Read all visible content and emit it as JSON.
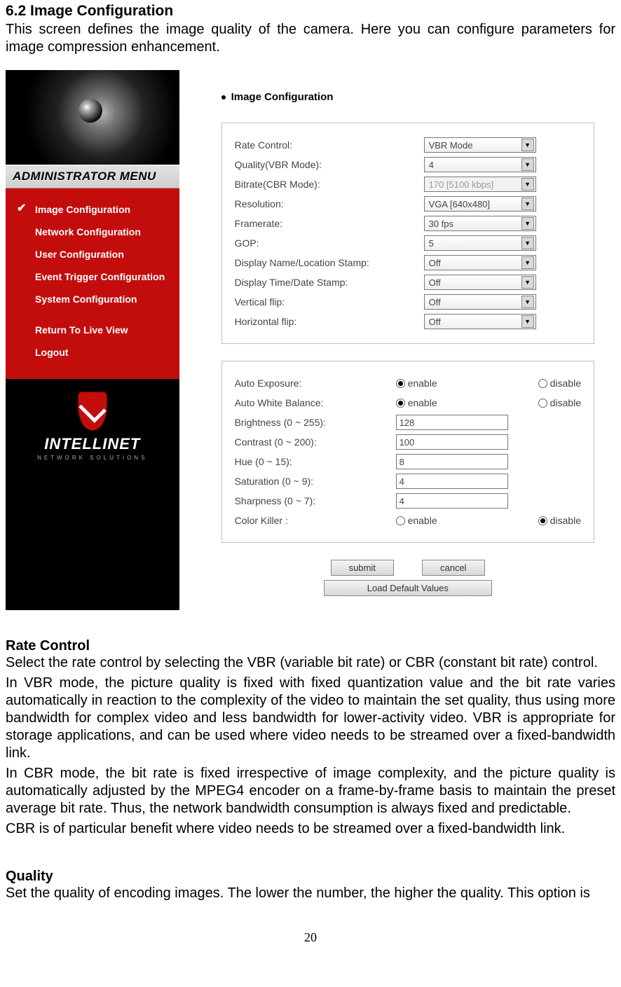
{
  "heading": "6.2 Image Configuration",
  "intro": "This screen defines the image quality of the camera. Here you can configure parameters for image compression enhancement.",
  "sidebar": {
    "admin_label": "ADMINISTRATOR MENU",
    "items": [
      {
        "label": "Image Configuration",
        "active": true
      },
      {
        "label": "Network Configuration",
        "active": false
      },
      {
        "label": "User Configuration",
        "active": false
      },
      {
        "label": "Event Trigger Configuration",
        "active": false
      },
      {
        "label": "System Configuration",
        "active": false
      }
    ],
    "items2": [
      {
        "label": "Return To Live View"
      },
      {
        "label": "Logout"
      }
    ],
    "brand": "INTELLINET",
    "brand_sub": "NETWORK SOLUTIONS"
  },
  "panel": {
    "title": "Image Configuration",
    "fields1": {
      "rate_control": {
        "label": "Rate Control:",
        "value": "VBR Mode"
      },
      "quality": {
        "label": "Quality(VBR Mode):",
        "value": "4"
      },
      "bitrate": {
        "label": "Bitrate(CBR Mode):",
        "value": "170 [5100 kbps]",
        "disabled": true
      },
      "resolution": {
        "label": "Resolution:",
        "value": "VGA [640x480]"
      },
      "framerate": {
        "label": "Framerate:",
        "value": "30 fps"
      },
      "gop": {
        "label": "GOP:",
        "value": "5"
      },
      "name_stamp": {
        "label": "Display Name/Location Stamp:",
        "value": "Off"
      },
      "date_stamp": {
        "label": "Display Time/Date Stamp:",
        "value": "Off"
      },
      "vflip": {
        "label": "Vertical flip:",
        "value": "Off"
      },
      "hflip": {
        "label": "Horizontal flip:",
        "value": "Off"
      }
    },
    "radio_enable": "enable",
    "radio_disable": "disable",
    "fields2": {
      "auto_exposure": {
        "label": "Auto Exposure:",
        "value": "enable"
      },
      "auto_wb": {
        "label": "Auto White Balance:",
        "value": "enable"
      },
      "brightness": {
        "label": "Brightness (0 ~ 255):",
        "value": "128"
      },
      "contrast": {
        "label": "Contrast (0 ~ 200):",
        "value": "100"
      },
      "hue": {
        "label": "Hue (0 ~ 15):",
        "value": "8"
      },
      "saturation": {
        "label": "Saturation (0 ~ 9):",
        "value": "4"
      },
      "sharpness": {
        "label": "Sharpness (0 ~ 7):",
        "value": "4"
      },
      "color_killer": {
        "label": "Color Killer :",
        "value": "disable"
      }
    },
    "buttons": {
      "submit": "submit",
      "cancel": "cancel",
      "load_defaults": "Load Default Values"
    }
  },
  "body": {
    "rc_head": "Rate Control",
    "rc_p1": "Select the rate control by selecting the VBR (variable bit rate) or CBR (constant bit rate) control.",
    "rc_p2": "In VBR mode, the picture quality is fixed with fixed quantization value and the bit rate varies automatically in reaction to the complexity of the video to maintain the set quality, thus using more bandwidth for complex video and less bandwidth for lower-activity video. VBR is appropriate for storage applications, and can be used where video needs to be streamed over a fixed-bandwidth link.",
    "rc_p3": "In CBR mode, the bit rate is fixed irrespective of image complexity, and the picture quality is automatically adjusted by the MPEG4 encoder on a frame-by-frame basis to maintain the preset average bit rate. Thus, the network bandwidth consumption is always fixed and predictable.",
    "rc_p4": "CBR is of particular benefit where video needs to be streamed over a fixed-bandwidth link.",
    "q_head": "Quality",
    "q_p1": "Set the quality of encoding images. The lower the number, the higher the quality. This option is"
  },
  "page_number": "20"
}
